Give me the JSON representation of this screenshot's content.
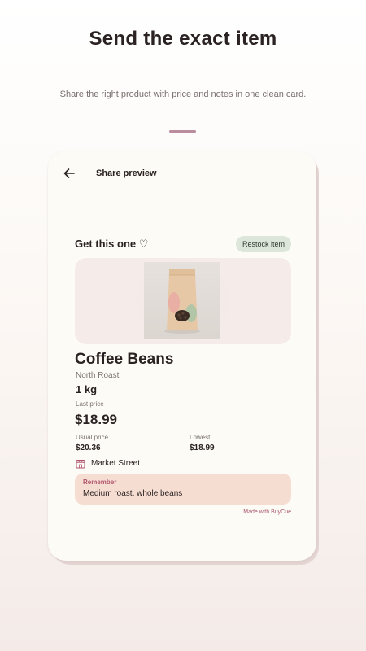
{
  "hero": {
    "title": "Send the exact item",
    "subtitle": "Share the right product with price and notes in one clean card."
  },
  "screen": {
    "topbar": {
      "back_icon": "arrow-left-icon",
      "title": "Share preview"
    },
    "card": {
      "header_title": "Get this one ♡",
      "restock_label": "Restock item",
      "product_image": "coffee-bag-photo",
      "product_name": "Coffee Beans",
      "variant": "North Roast",
      "quantity": "1 kg",
      "last_price_label": "Last price",
      "last_price": "$18.99",
      "usual_price_label": "Usual price",
      "usual_price": "$20.36",
      "lowest_label": "Lowest",
      "lowest_price": "$18.99",
      "store_icon": "storefront-icon",
      "store_name": "Market Street",
      "note_label": "Remember",
      "note_text": "Medium roast, whole beans",
      "footer": "Made with BuyCue"
    }
  },
  "colors": {
    "accent_bar": "#b98c9e",
    "restock_bg": "#dde6da",
    "note_bg": "#f6ddd2",
    "note_label": "#b0566a",
    "brand_footer": "#a9586b",
    "card_bg": "#fdfbf6"
  }
}
